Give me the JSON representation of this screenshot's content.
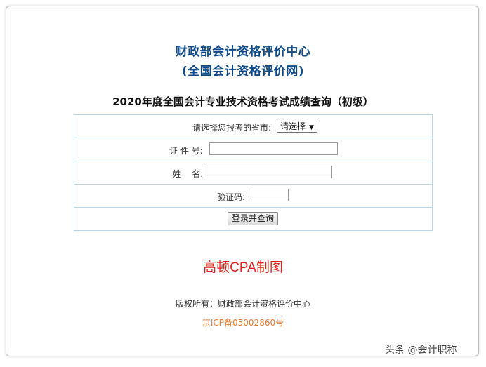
{
  "header": {
    "org_name": "财政部会计资格评价中心",
    "site_name": "(全国会计资格评价网)",
    "page_title": "2020年度全国会计专业技术资格考试成绩查询（初级）"
  },
  "form": {
    "province_label": "请选择您报考的省市:",
    "province_select_value": "请选择",
    "id_label": "证 件 号:",
    "id_value": "",
    "name_label": "姓    名:",
    "name_value": "",
    "captcha_label": "验证码:",
    "captcha_value": "",
    "submit_label": "登录并查询"
  },
  "watermark": "高顿CPA制图",
  "footer": {
    "copyright": "版权所有：财政部会计资格评价中心",
    "icp": "京ICP备05002860号",
    "source_tag": "头条 @会计职称"
  },
  "colors": {
    "title_blue": "#0f4a8a",
    "border_light_blue": "#b9d6ea",
    "watermark_red": "#e2231a",
    "icp_orange": "#e87a2e"
  }
}
